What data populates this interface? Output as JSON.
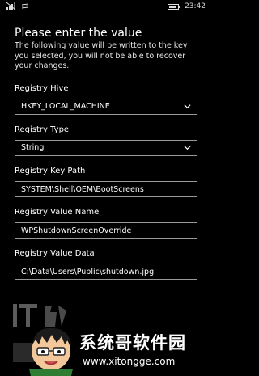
{
  "status": {
    "time": "23:42",
    "battery_level": 0.9,
    "icons": [
      "signal-icon",
      "notification-icon",
      "battery-icon"
    ]
  },
  "dialog": {
    "title": "Please enter the value",
    "description": "The following value will be written to the key you selected, you will not be able to recover your changes."
  },
  "fields": {
    "hive": {
      "label": "Registry Hive",
      "value": "HKEY_LOCAL_MACHINE"
    },
    "type": {
      "label": "Registry Type",
      "value": "String"
    },
    "key_path": {
      "label": "Registry Key Path",
      "value": "SYSTEM\\Shell\\OEM\\BootScreens"
    },
    "value_name": {
      "label": "Registry Value Name",
      "value": "WPShutdownScreenOverride"
    },
    "value_data": {
      "label": "Registry Value Data",
      "value": "C:\\Data\\Users\\Public\\shutdown.jpg"
    }
  },
  "watermark": {
    "site_name": "系统哥软件园",
    "site_url": "www.xitongge.com"
  },
  "colors": {
    "background": "#000000",
    "border": "#9a9a9a",
    "text": "#ffffff"
  }
}
